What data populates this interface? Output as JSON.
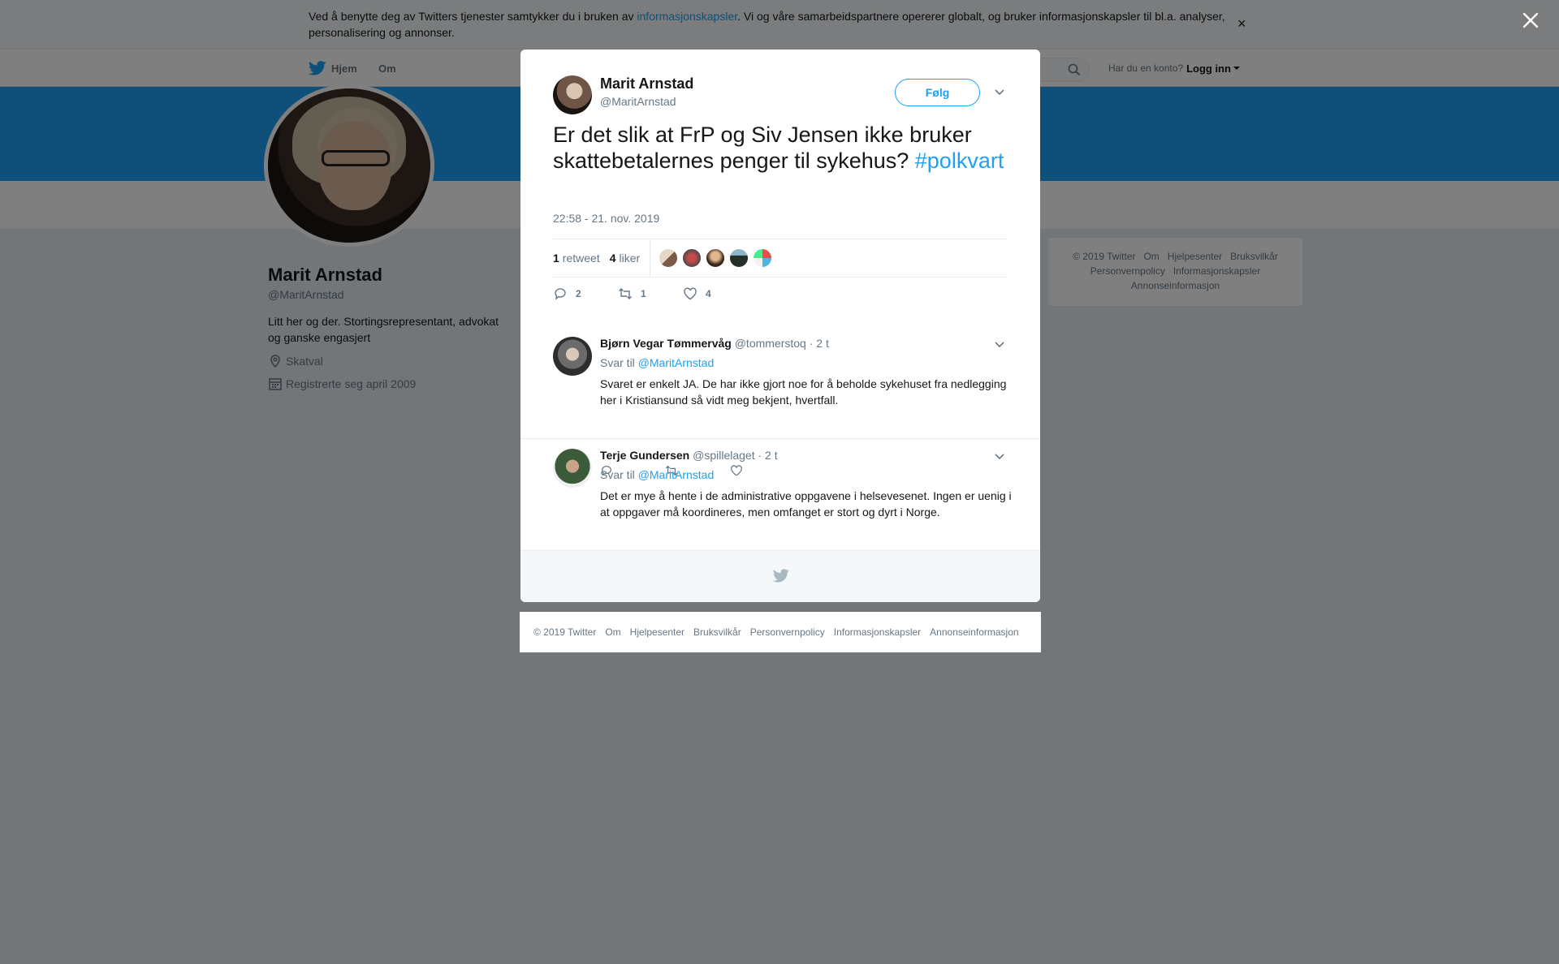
{
  "cookie": {
    "text_before": "Ved å benytte deg av Twitters tjenester samtykker du i bruken av ",
    "link": "informasjonskapsler",
    "text_after": ". Vi og våre samarbeidspartnere opererer globalt, og bruker informasjonskapsler til bl.a. analyser, personalisering og annonser.",
    "close": "×"
  },
  "nav": {
    "home": "Hjem",
    "about": "Om",
    "login_prompt": "Har du en konto?",
    "login": "Logg inn"
  },
  "profile": {
    "name": "Marit Arnstad",
    "handle": "@MaritArnstad",
    "bio": "Litt her og der. Stortingsrepresentant, advokat og ganske engasjert",
    "location": "Skatval",
    "joined": "Registrerte seg april 2009"
  },
  "side_footer": {
    "copyright": "© 2019 Twitter",
    "om": "Om",
    "help": "Hjelpesenter",
    "terms": "Bruksvilkår",
    "privacy": "Personvernpolicy",
    "cookies": "Informasjonskapsler",
    "ads": "Annonseinformasjon"
  },
  "tweet": {
    "name": "Marit Arnstad",
    "handle": "@MaritArnstad",
    "follow": "Følg",
    "text": "Er det slik at FrP og Siv Jensen ikke bruker skattebetalernes penger til sykehus? ",
    "hashtag": "#polkvart",
    "time": "22:58 - 21. nov. 2019",
    "retweets_count": "1",
    "retweets_label": "retweet",
    "likes_count": "4",
    "likes_label": "liker",
    "reply_count": "2",
    "retweet_count": "1",
    "like_count": "4"
  },
  "replies": [
    {
      "name": "Bjørn Vegar Tømmervåg",
      "handle": "@tommerstoq",
      "time": "· 2 t",
      "reply_to_label": "Svar til",
      "reply_to": "@MaritArnstad",
      "text": "Svaret er enkelt JA. De har ikke gjort noe for å beholde sykehuset fra nedlegging her i Kristiansund så vidt meg bekjent, hvertfall."
    },
    {
      "name": "Terje Gundersen",
      "handle": "@spillelaget",
      "time": "· 2 t",
      "reply_to_label": "Svar til",
      "reply_to": "@MaritArnstad",
      "text": "Det er mye å hente i de administrative oppgavene i helsevesenet.  Ingen er uenig i at oppgaver må koordineres, men omfanget er stort og dyrt i Norge."
    }
  ],
  "footer": {
    "copyright": "© 2019 Twitter",
    "om": "Om",
    "help": "Hjelpesenter",
    "terms": "Bruksvilkår",
    "privacy": "Personvernpolicy",
    "cookies": "Informasjonskapsler",
    "ads": "Annonseinformasjon"
  },
  "colors": {
    "accent": "#1da1f2",
    "text": "#14171a",
    "muted": "#657786"
  },
  "icons": [
    "twitter-bird-icon",
    "search-icon",
    "close-icon",
    "chevron-down-icon",
    "reply-icon",
    "retweet-icon",
    "like-icon",
    "location-icon",
    "calendar-icon"
  ]
}
